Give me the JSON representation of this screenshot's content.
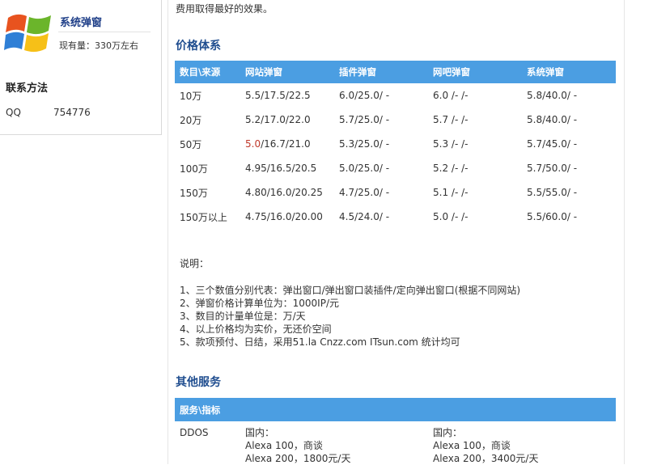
{
  "sidebar": {
    "brand_title": "系统弹窗",
    "brand_sub": "现有量：330万左右",
    "contact_title": "联系方法",
    "contact_label": "QQ",
    "contact_value": "754776"
  },
  "main": {
    "intro": "费用取得最好的效果。",
    "price_section_title": "价格体系",
    "price_table": {
      "headers": [
        "数目\\来源",
        "网站弹窗",
        "插件弹窗",
        "网吧弹窗",
        "系统弹窗"
      ],
      "rows": [
        [
          "10万",
          "5.5/17.5/22.5",
          "6.0/25.0/ -",
          "6.0 /- /-",
          "5.8/40.0/ -"
        ],
        [
          "20万",
          "5.2/17.0/22.0",
          "5.7/25.0/ -",
          "5.7 /- /-",
          "5.8/40.0/ -"
        ],
        [
          "50万",
          "5.0",
          "/16.7/21.0",
          "5.3/25.0/ -",
          "5.3 /- /-",
          "5.7/45.0/ -"
        ],
        [
          "100万",
          "4.95/16.5/20.5",
          "5.0/25.0/ -",
          "5.2 /- /-",
          "5.7/50.0/ -"
        ],
        [
          "150万",
          "4.80/16.0/20.25",
          "4.7/25.0/ -",
          "5.1 /- /-",
          "5.5/55.0/ -"
        ],
        [
          "150万以上",
          "4.75/16.0/20.00",
          "4.5/24.0/ -",
          "5.0 /- /-",
          "5.5/60.0/ -"
        ]
      ],
      "highlight_color": "#c0392b"
    },
    "notes_title": "说明：",
    "notes": [
      "1、三个数值分别代表：弹出窗口/弹出窗口装插件/定向弹出窗口(根据不同网站)",
      "2、弹窗价格计算单位为：1000IP/元",
      "3、数目的计量单位是：万/天",
      "4、以上价格均为实价，无还价空间",
      "5、款项预付、日结，采用51.la Cnzz.com ITsun.com 统计均可"
    ],
    "other_section_title": "其他服务",
    "service_table": {
      "header": "服务\\指标",
      "row_label": "DDOS",
      "col1": [
        "国内：",
        "Alexa 100，商谈",
        "Alexa 200，1800元/天"
      ],
      "col2": [
        "国内：",
        "Alexa 100，商谈",
        "Alexa 200，3400元/天"
      ]
    }
  },
  "colors": {
    "accent": "#4b9ee2",
    "title_blue": "#1f4d8f"
  }
}
